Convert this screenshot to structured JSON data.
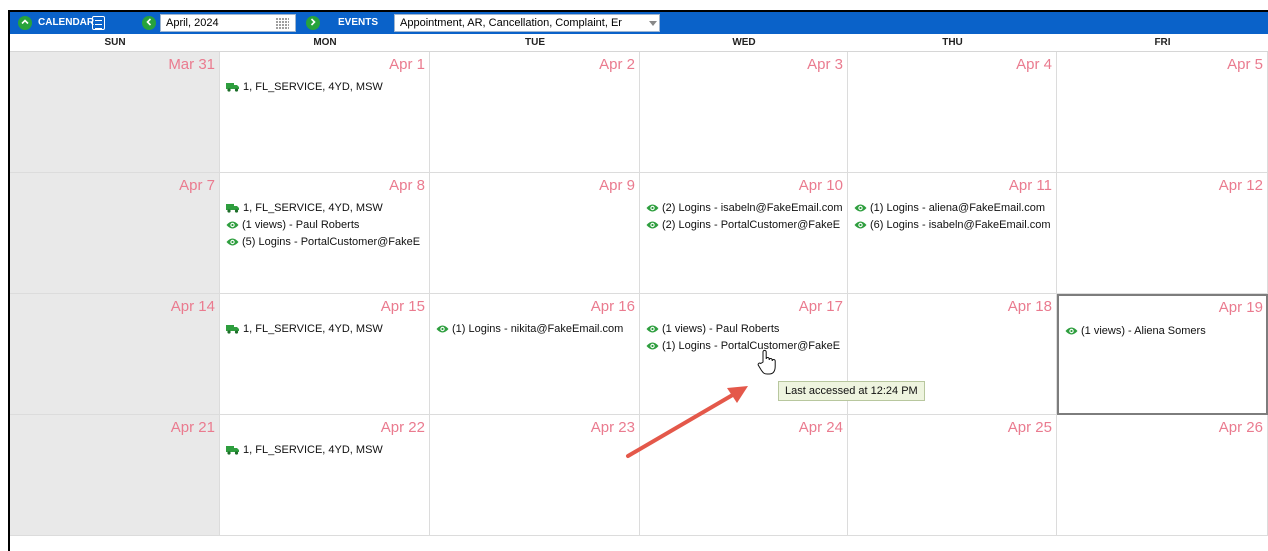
{
  "toolbar": {
    "calendar_label": "CALENDAR",
    "month_value": "April, 2024",
    "events_label": "EVENTS",
    "events_filter_value": "Appointment, AR, Cancellation, Complaint, Er",
    "accent_color": "#0a62c9",
    "button_color": "#27a33b"
  },
  "days": [
    "SUN",
    "MON",
    "TUE",
    "WED",
    "THU",
    "FRI"
  ],
  "weeks": [
    {
      "dates": [
        "Mar 31",
        "Apr 1",
        "Apr 2",
        "Apr 3",
        "Apr 4",
        "Apr 5"
      ],
      "events": [
        [],
        [
          {
            "icon": "truck-icon",
            "text": "1, FL_SERVICE, 4YD, MSW"
          }
        ],
        [],
        [],
        [],
        []
      ]
    },
    {
      "dates": [
        "Apr 7",
        "Apr 8",
        "Apr 9",
        "Apr 10",
        "Apr 11",
        "Apr 12"
      ],
      "events": [
        [],
        [
          {
            "icon": "truck-icon",
            "text": "1, FL_SERVICE, 4YD, MSW"
          },
          {
            "icon": "eye-icon",
            "text": "(1 views) - Paul Roberts"
          },
          {
            "icon": "eye-icon",
            "text": "(5) Logins - PortalCustomer@FakeE"
          }
        ],
        [],
        [
          {
            "icon": "eye-icon",
            "text": "(2) Logins - isabeln@FakeEmail.com"
          },
          {
            "icon": "eye-icon",
            "text": "(2) Logins - PortalCustomer@FakeE"
          }
        ],
        [
          {
            "icon": "eye-icon",
            "text": "(1) Logins - aliena@FakeEmail.com"
          },
          {
            "icon": "eye-icon",
            "text": "(6) Logins - isabeln@FakeEmail.com"
          }
        ],
        []
      ]
    },
    {
      "dates": [
        "Apr 14",
        "Apr 15",
        "Apr 16",
        "Apr 17",
        "Apr 18",
        "Apr 19"
      ],
      "events": [
        [],
        [
          {
            "icon": "truck-icon",
            "text": "1, FL_SERVICE, 4YD, MSW"
          }
        ],
        [
          {
            "icon": "eye-icon",
            "text": "(1) Logins - nikita@FakeEmail.com"
          }
        ],
        [
          {
            "icon": "eye-icon",
            "text": "(1 views) - Paul Roberts"
          },
          {
            "icon": "eye-icon",
            "text": "(1) Logins - PortalCustomer@FakeE"
          }
        ],
        [],
        [
          {
            "icon": "eye-icon",
            "text": "(1 views) - Aliena Somers"
          }
        ]
      ]
    },
    {
      "dates": [
        "Apr 21",
        "Apr 22",
        "Apr 23",
        "Apr 24",
        "Apr 25",
        "Apr 26"
      ],
      "events": [
        [],
        [
          {
            "icon": "truck-icon",
            "text": "1, FL_SERVICE, 4YD, MSW"
          }
        ],
        [],
        [],
        [],
        []
      ]
    }
  ],
  "tooltip": {
    "text": "Last accessed at 12:24 PM"
  },
  "colors": {
    "date_text": "#ea7b8f",
    "event_icon": "#2e9e3e",
    "sunday_bg": "#e9e9e9",
    "annotation_arrow": "#e4584a"
  }
}
